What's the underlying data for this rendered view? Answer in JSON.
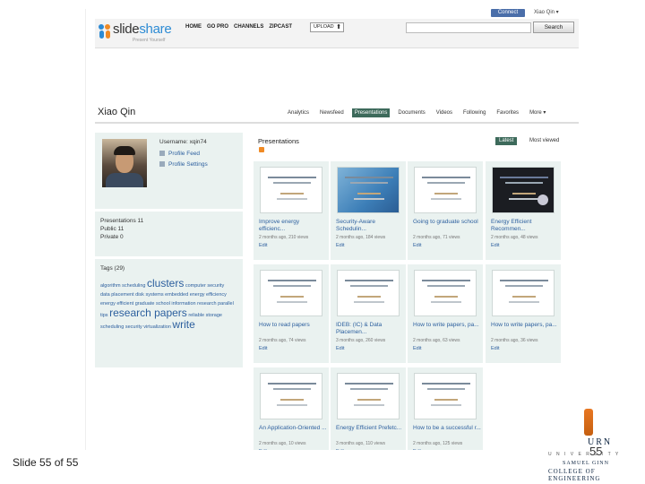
{
  "topbar": {
    "connect_label": "Connect",
    "user_label": "Xiao Qin ▾"
  },
  "header": {
    "logo_main": "slide",
    "logo_accent": "share",
    "logo_sub": "Present Yourself",
    "nav": [
      "HOME",
      "GO PRO",
      "CHANNELS",
      "ZIPCAST"
    ],
    "upload_label": "UPLOAD",
    "search_placeholder": "",
    "search_label": "Search"
  },
  "profile": {
    "name": "Xiao Qin",
    "tabs": [
      "Analytics",
      "Newsfeed",
      "Presentations",
      "Documents",
      "Videos",
      "Following",
      "Favorites",
      "More ▾"
    ],
    "active_tab": "Presentations",
    "username": "Username: xqin74",
    "links": [
      "Profile Feed",
      "Profile Settings"
    ],
    "stats": [
      "Presentations 11",
      "Public 11",
      "Private 0"
    ],
    "tags_header": "Tags (29)"
  },
  "tags": {
    "t1": "algorithm",
    "t2": "scheduling",
    "t3": "clusters",
    "t4": "computer security",
    "t5": "data placement",
    "t6": "disk systems",
    "t7": "embedded",
    "t8": "energy",
    "t9": "efficiency energy efficient",
    "t10": "graduate school",
    "t11": "information",
    "t12": "research",
    "t13": "parallel",
    "t14": "tips",
    "t15": "research papers",
    "t16": "reliable storage",
    "t17": "scheduling security virtualization",
    "t18": "write"
  },
  "presentations": {
    "title": "Presentations",
    "sort_latest": "Latest",
    "sort_most_viewed": "Most viewed",
    "cards": [
      {
        "title": "Improve energy efficienc...",
        "meta": "2 months ago, 210 views",
        "edit": "Edit",
        "thumb": "doc"
      },
      {
        "title": "Security-Aware Schedulin...",
        "meta": "2 months ago, 184 views",
        "edit": "Edit",
        "thumb": "map"
      },
      {
        "title": "Going to graduate school",
        "meta": "2 months ago, 71 views",
        "edit": "Edit",
        "thumb": "doc"
      },
      {
        "title": "Energy Efficient Recommen...",
        "meta": "2 months ago, 48 views",
        "edit": "Edit",
        "thumb": "dark"
      },
      {
        "title": "How to read papers",
        "meta": "2 months ago, 74 views",
        "edit": "Edit",
        "thumb": "doc"
      },
      {
        "title": "IDEB: (IC) & Data Placemen...",
        "meta": "3 months ago, 260 views",
        "edit": "Edit",
        "thumb": "doc"
      },
      {
        "title": "How to write papers, pa...",
        "meta": "2 months ago, 63 views",
        "edit": "Edit",
        "thumb": "doc"
      },
      {
        "title": "How to write papers, pa...",
        "meta": "2 months ago, 36 views",
        "edit": "Edit",
        "thumb": "doc"
      },
      {
        "title": "An Application-Oriented ...",
        "meta": "2 months ago, 10 views",
        "edit": "Edit",
        "thumb": "doc"
      },
      {
        "title": "Energy Efficient Prefetc...",
        "meta": "3 months ago, 110 views",
        "edit": "Edit",
        "thumb": "doc"
      },
      {
        "title": "How to be a successful r...",
        "meta": "2 months ago, 125 views",
        "edit": "Edit",
        "thumb": "doc"
      }
    ]
  },
  "slide": {
    "footer": "Slide 55 of 55",
    "number": "55",
    "univ_line1": "URN",
    "univ_line2": "U N I V E R S I T Y",
    "univ_line3": "SAMUEL GINN",
    "univ_line4": "COLLEGE OF ENGINEERING"
  },
  "colors": {
    "accent": "#3d6a5b",
    "link": "#2c5f9e",
    "panel": "#eaf2f0"
  }
}
